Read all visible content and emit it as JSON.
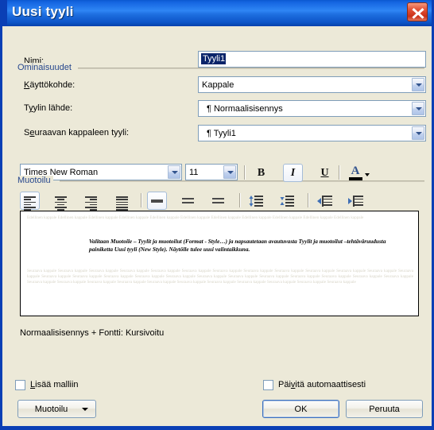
{
  "window": {
    "title": "Uusi tyyli",
    "close_icon": "close-icon"
  },
  "properties": {
    "group_label": "Ominaisuudet",
    "rows": [
      {
        "label_pre": "N",
        "label_accel": "i",
        "label_post": "mi:",
        "label_full": "Nimi:",
        "value": "Tyyli1",
        "type": "text",
        "selected": true
      },
      {
        "label_pre": "",
        "label_accel": "K",
        "label_post": "äyttökohde:",
        "label_full": "Käyttökohde:",
        "value": "Kappale",
        "type": "combo"
      },
      {
        "label_pre": "T",
        "label_accel": "y",
        "label_post": "ylin lähde:",
        "label_full": "Tyylin lähde:",
        "value": "¶ Normaalisisennys",
        "type": "combo"
      },
      {
        "label_pre": "S",
        "label_accel": "e",
        "label_post": "uraavan kappaleen tyyli:",
        "label_full": "Seuraavan kappaleen tyyli:",
        "value": "¶ Tyyli1",
        "type": "combo"
      }
    ]
  },
  "formatting": {
    "group_label": "Muotoilu",
    "font_family": "Times New Roman",
    "font_size": "11",
    "bold_label": "B",
    "italic_label": "I",
    "underline_label": "U",
    "font_color_label": "A",
    "font_color_value": "#000000",
    "buttons": [
      {
        "name": "font-family-combo",
        "label": "Times New Roman"
      },
      {
        "name": "font-size-combo",
        "label": "11"
      },
      {
        "name": "bold-button",
        "label": "B",
        "active": false
      },
      {
        "name": "italic-button",
        "label": "I",
        "active": true
      },
      {
        "name": "underline-button",
        "label": "U",
        "active": false
      },
      {
        "name": "font-color-button",
        "label": "A",
        "active": false
      },
      {
        "name": "align-left-button",
        "label": "Tasaa vasemmalle",
        "active": true
      },
      {
        "name": "align-center-button",
        "label": "Keskitä",
        "active": false
      },
      {
        "name": "align-right-button",
        "label": "Tasaa oikealle",
        "active": false
      },
      {
        "name": "align-justify-button",
        "label": "Tasaa molemmat reunat",
        "active": false
      },
      {
        "name": "line-spacing-single-button",
        "label": "Riviväli 1",
        "active": true
      },
      {
        "name": "line-spacing-1-5-button",
        "label": "Riviväli 1,5",
        "active": false
      },
      {
        "name": "line-spacing-double-button",
        "label": "Riviväli 2",
        "active": false
      },
      {
        "name": "decrease-paragraph-spacing-button",
        "label": "Pienennä kappaleen väliä",
        "active": false
      },
      {
        "name": "increase-paragraph-spacing-button",
        "label": "Suurenna kappaleen väliä",
        "active": false
      },
      {
        "name": "decrease-indent-button",
        "label": "Pienennä sisennystä",
        "active": false
      },
      {
        "name": "increase-indent-button",
        "label": "Suurenna sisennystä",
        "active": false
      }
    ]
  },
  "preview": {
    "before_text": "Edellinen kappale Edellinen kappale Edellinen kappale Edellinen kappale Edellinen kappale Edellinen kappale Edellinen kappale Edellinen kappale Edellinen kappale Edellinen kappale Edellinen kappale",
    "main_text": "Valitaan Muotoile – Tyylit ja muotoilut (Format - Style…) ja napsautetaan avautuvasta Tyylit ja muotoilut –tehtäväruudusta painiketta Uusi tyyli (New Style). Näytölle tulee uusi valintaikkuna.",
    "after_text": "Seuraava kappale Seuraava kappale Seuraava kappale Seuraava kappale Seuraava kappale Seuraava kappale Seuraava kappale Seuraava kappale Seuraava kappale Seuraava kappale Seuraava kappale Seuraava kappale Seuraava kappale Seuraava kappale Seuraava kappale Seuraava kappale Seuraava kappale Seuraava kappale Seuraava kappale Seuraava kappale Seuraava kappale Seuraava kappale Seuraava kappale Seuraava kappale Seuraava kappale Seuraava kappale Seuraava kappale Seuraava kappale Seuraava kappale Seuraava kappale Seuraava kappale Seuraava kappale Seuraava kappale Seuraava kappale Seuraava kappale Seuraava kappale"
  },
  "description": "Normaalisisennys + Fontti: Kursivoitu",
  "options": {
    "add_to_template": {
      "label_pre": "",
      "label_accel": "L",
      "label_post": "isää malliin",
      "label_full": "Lisää malliin",
      "checked": false
    },
    "auto_update": {
      "label_pre": "Päi",
      "label_accel": "v",
      "label_post": "itä automaattisesti",
      "label_full": "Päivitä automaattisesti",
      "checked": false
    }
  },
  "footer": {
    "format_button": "Muotoilu",
    "ok_button": "OK",
    "cancel_button": "Peruuta"
  },
  "colors": {
    "titlebar_blue": "#1464e0",
    "border_blue": "#0a3fb5",
    "dialog_bg": "#ece9d8",
    "group_label": "#26478d",
    "selection": "#0a246a",
    "close_red": "#c92f16"
  }
}
